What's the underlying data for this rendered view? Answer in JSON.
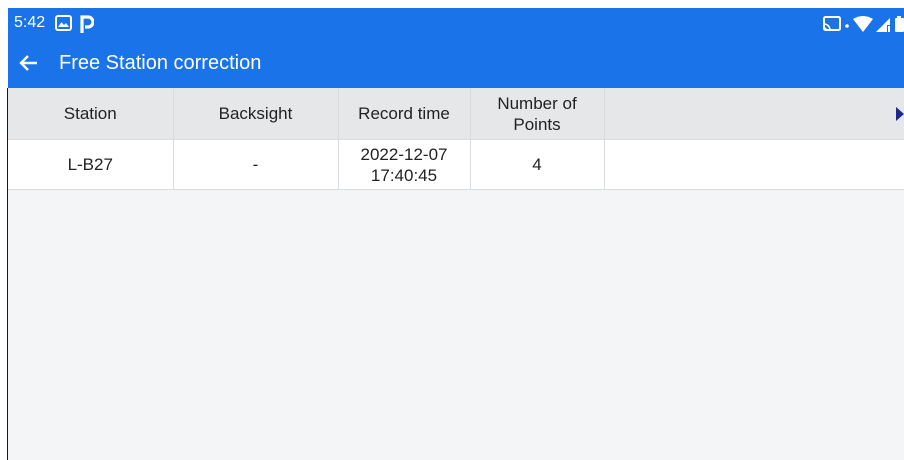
{
  "status_bar": {
    "time": "5:42",
    "icons": [
      "photos-app-icon",
      "parking-app-icon",
      "cast-icon",
      "dot-icon",
      "wifi-icon",
      "signal-icon",
      "battery-icon"
    ]
  },
  "app_bar": {
    "title": "Free Station correction",
    "back_icon": "back-arrow-icon"
  },
  "table": {
    "headers": [
      "Station",
      "Backsight",
      "Record time",
      "Number of Points"
    ],
    "rows": [
      {
        "station": "L-B27",
        "backsight": "-",
        "record_time": "2022-12-07 17:40:45",
        "points": "4"
      }
    ]
  },
  "colors": {
    "app_bar": "#1a73e8",
    "background": "#f4f5f6",
    "header_row": "#e6e7e9",
    "scroll_indicator": "#1b2a8c"
  }
}
